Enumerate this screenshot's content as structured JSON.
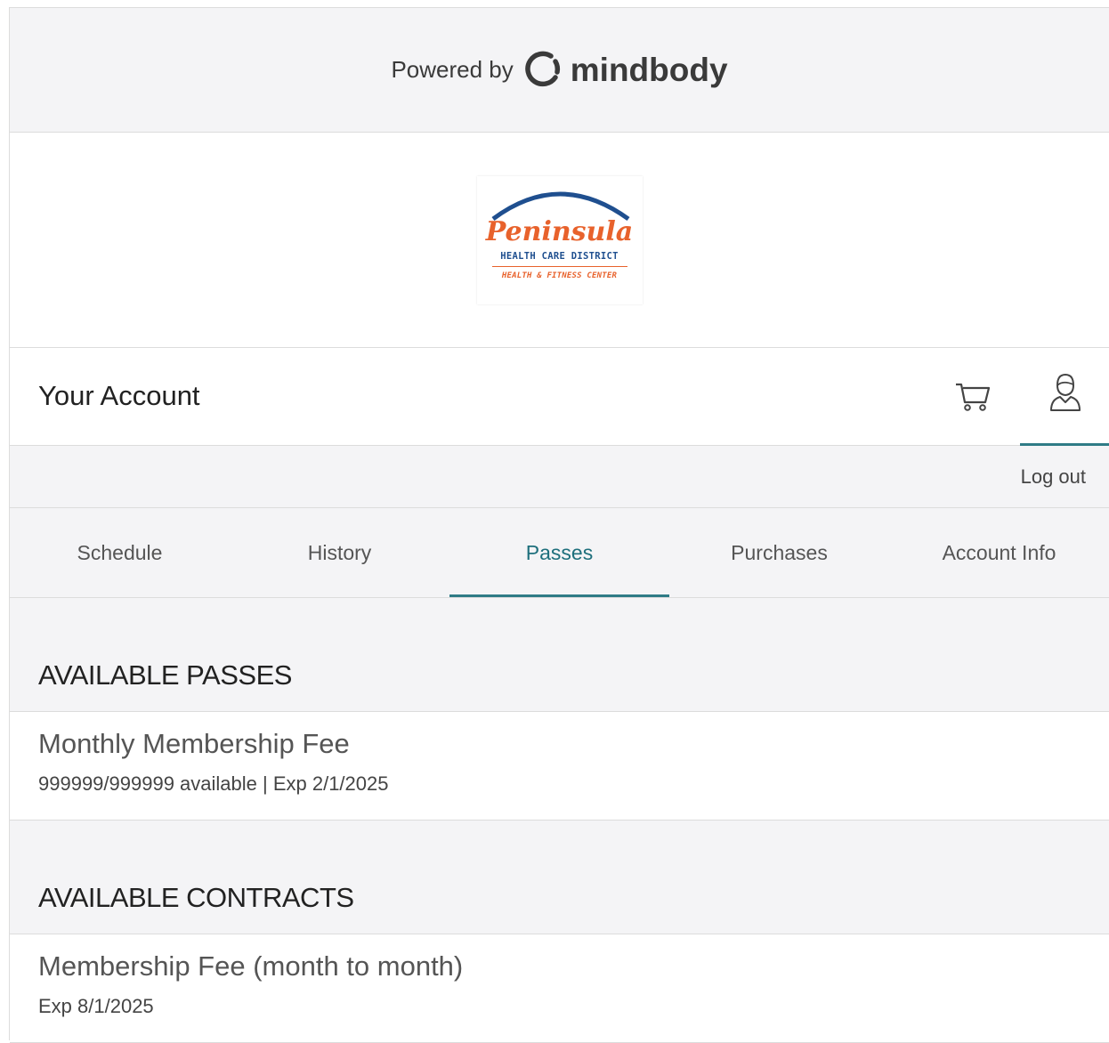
{
  "header": {
    "powered_by": "Powered by",
    "brand_name": "mindbody"
  },
  "logo": {
    "script_name": "Peninsula",
    "line1": "HEALTH CARE DISTRICT",
    "line2": "HEALTH & FITNESS CENTER",
    "colors": {
      "arc": "#1f4f8f",
      "script": "#e8622c"
    }
  },
  "account": {
    "title": "Your Account",
    "cart_icon": "cart-icon",
    "profile_icon": "user-profile-icon",
    "logout_label": "Log out"
  },
  "tabs": [
    {
      "label": "Schedule",
      "active": false
    },
    {
      "label": "History",
      "active": false
    },
    {
      "label": "Passes",
      "active": true
    },
    {
      "label": "Purchases",
      "active": false
    },
    {
      "label": "Account Info",
      "active": false
    }
  ],
  "sections": {
    "passes": {
      "title": "AVAILABLE PASSES",
      "items": [
        {
          "name": "Monthly Membership Fee",
          "meta": "999999/999999 available | Exp 2/1/2025"
        }
      ]
    },
    "contracts": {
      "title": "AVAILABLE CONTRACTS",
      "items": [
        {
          "name": "Membership Fee (month to month)",
          "meta": "Exp 8/1/2025"
        }
      ]
    }
  },
  "theme": {
    "accent": "#2f7b86",
    "background": "#f4f4f6",
    "border": "#dcdcdc"
  }
}
